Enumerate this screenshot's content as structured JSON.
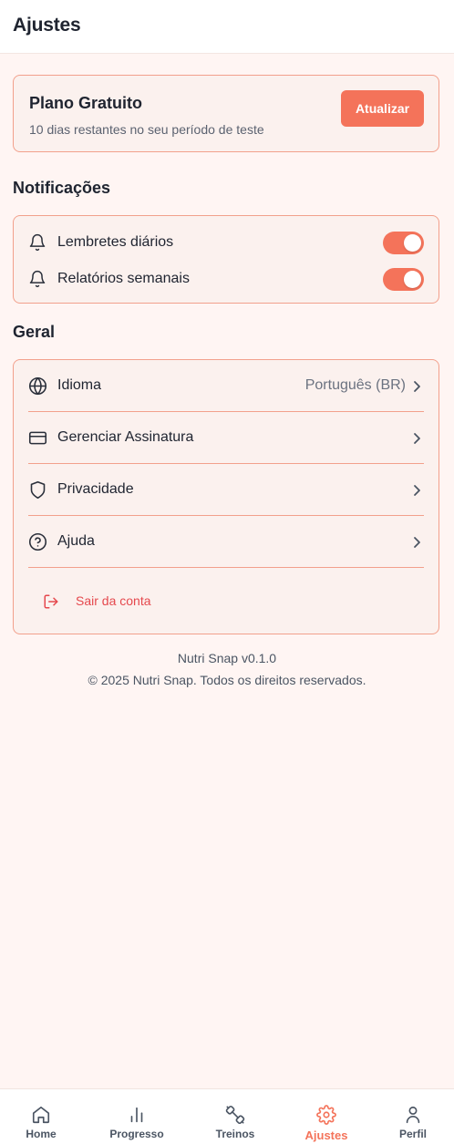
{
  "header": {
    "title": "Ajustes"
  },
  "plan": {
    "title": "Plano Gratuito",
    "subtitle": "10 dias restantes no seu período de teste",
    "upgrade_label": "Atualizar"
  },
  "notifications": {
    "section_title": "Notificações",
    "items": [
      {
        "label": "Lembretes diários",
        "icon": "bell-icon",
        "enabled": true
      },
      {
        "label": "Relatórios semanais",
        "icon": "bell-icon",
        "enabled": true
      }
    ]
  },
  "general": {
    "section_title": "Geral",
    "items": [
      {
        "label": "Idioma",
        "value": "Português (BR)",
        "icon": "globe-icon"
      },
      {
        "label": "Gerenciar Assinatura",
        "icon": "credit-card-icon"
      },
      {
        "label": "Privacidade",
        "icon": "shield-icon"
      },
      {
        "label": "Ajuda",
        "icon": "help-circle-icon"
      }
    ],
    "logout_label": "Sair da conta"
  },
  "footer": {
    "version": "Nutri Snap v0.1.0",
    "copyright": "© 2025 Nutri Snap. Todos os direitos reservados."
  },
  "bottom_nav": {
    "active": "Ajustes",
    "items": [
      {
        "label": "Home",
        "icon": "home-icon"
      },
      {
        "label": "Progresso",
        "icon": "bar-chart-icon"
      },
      {
        "label": "Treinos",
        "icon": "dumbbell-icon"
      },
      {
        "label": "Ajustes",
        "icon": "settings-icon"
      },
      {
        "label": "Perfil",
        "icon": "user-icon"
      }
    ]
  },
  "colors": {
    "accent": "#f4735a",
    "card_background": "#fbf1ee",
    "card_border": "#f2a08c",
    "page_background": "#fff5f3",
    "logout_red": "#e5484d"
  }
}
